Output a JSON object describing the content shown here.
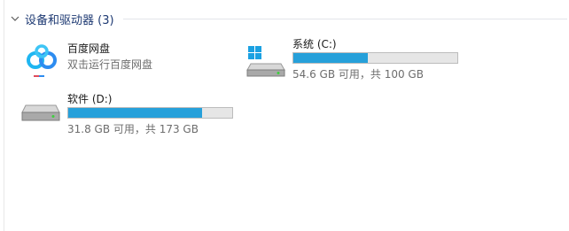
{
  "group": {
    "title": "设备和驱动器 (3)"
  },
  "items": [
    {
      "name": "百度网盘",
      "description": "双击运行百度网盘",
      "icon": "baidu-netdisk-icon"
    },
    {
      "name": "系统 (C:)",
      "space": "54.6 GB 可用，共 100 GB",
      "used_fraction": 0.454,
      "icon": "windows-drive-icon"
    },
    {
      "name": "软件 (D:)",
      "space": "31.8 GB 可用，共 173 GB",
      "used_fraction": 0.816,
      "icon": "hard-drive-icon"
    }
  ],
  "colors": {
    "bar_fill": "#26a0da",
    "bar_track": "#e6e6e6",
    "header_text": "#1e3a73"
  }
}
